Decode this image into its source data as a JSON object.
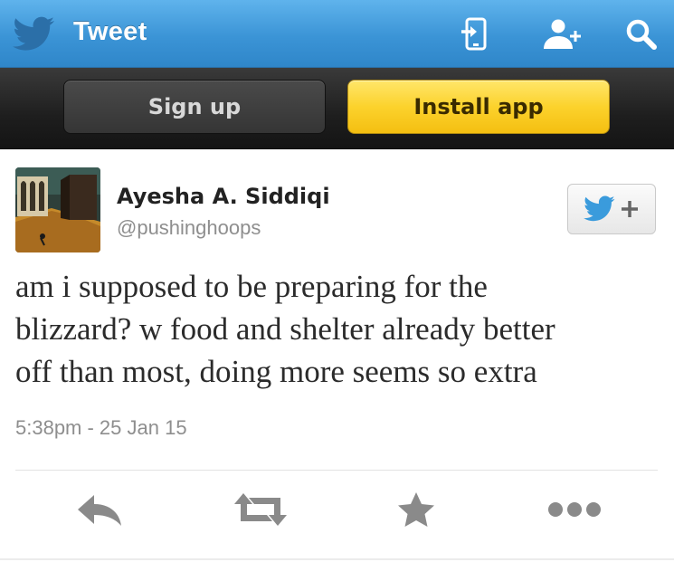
{
  "header": {
    "title": "Tweet",
    "logo_icon": "twitter-bird-icon",
    "icons": [
      "sign-in-icon",
      "add-user-icon",
      "search-icon"
    ],
    "accent_color": "#3b94d6"
  },
  "actions": {
    "signup_label": "Sign up",
    "install_label": "Install app",
    "install_color": "#fcd22c"
  },
  "tweet": {
    "author_name": "Ayesha A. Siddiqi",
    "handle": "@pushinghoops",
    "text_lines": [
      "am i supposed to be preparing for the",
      "blizzard? w food and shelter already better",
      "off than most, doing more seems so extra"
    ],
    "timestamp": "5:38pm - 25 Jan 15",
    "follow_icon": "twitter-follow-icon"
  },
  "tweet_actions": [
    "reply-icon",
    "retweet-icon",
    "favorite-icon",
    "more-icon"
  ]
}
